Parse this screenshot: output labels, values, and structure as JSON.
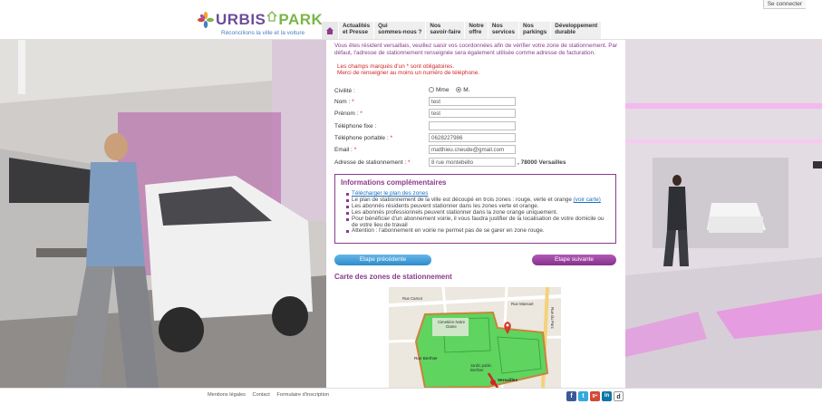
{
  "header": {
    "brand_part1": "URBIS",
    "brand_part2": "PARK",
    "tagline": "Réconcilions la ville et la voiture",
    "connect_label": "Se connecter"
  },
  "nav": {
    "items": [
      {
        "l1": "Actualités",
        "l2": "et Presse"
      },
      {
        "l1": "Qui",
        "l2": "sommes-nous ?"
      },
      {
        "l1": "Nos",
        "l2": "savoir-faire"
      },
      {
        "l1": "Notre",
        "l2": "offre"
      },
      {
        "l1": "Nos",
        "l2": "services"
      },
      {
        "l1": "Nos",
        "l2": "parkings"
      },
      {
        "l1": "Développement",
        "l2": "durable"
      }
    ]
  },
  "form": {
    "intro": "Vous êtes résident versaillais, veuillez saisir vos coordonnées afin de vérifier votre zone de stationnement. Par défaut, l'adresse de stationnement renseignée sera également utilisée comme adresse de facturation.",
    "warn1": "Les champs marqués d'un * sont obligatoires.",
    "warn2": "Merci de renseigner au moins un numéro de téléphone.",
    "civilite_label": "Civilité :",
    "civ_mme": "Mme",
    "civ_m": "M.",
    "nom_label": "Nom :",
    "nom_value": "test",
    "prenom_label": "Prénom :",
    "prenom_value": "test",
    "tel_fixe_label": "Téléphone fixe :",
    "tel_fixe_value": "",
    "tel_port_label": "Téléphone portable :",
    "tel_port_value": "0628227986",
    "email_label": "Email :",
    "email_value": "matthieu.cneude@gmail.com",
    "adresse_label": "Adresse de stationnement :",
    "adresse_value": "8 rue montebello",
    "ville": ", 78000 Versailles",
    "req": "*"
  },
  "info": {
    "title": "Informations complémentaires",
    "download_link": "Télécharger le plan des zones",
    "line1": "Le plan de stationnement de la ville est découpé en trois zones : rouge, verte et orange",
    "line1_link": "(voir carte)",
    "line2": "Les abonnés résidents peuvent stationner dans les zones verte et orange.",
    "line3": "Les abonnés professionnels peuvent stationner dans la zone orange uniquement.",
    "line4": "Pour bénéficier d'un abonnement voirie, il vous faudra justifier de la localisation de votre domicile ou de votre lieu de travail",
    "line5": "Attention : l'abonnement en voirie ne permet pas de se garer en zone rouge."
  },
  "buttons": {
    "prev": "Etape précédente",
    "next": "Etape suivante"
  },
  "map": {
    "title": "Carte des zones de stationnement",
    "labels": {
      "cimetiere": "Cimetière Notre Dame",
      "rue_berthier": "Rue Berthier",
      "rue_mansart": "Rue Mansart",
      "jardin": "Jardin public Berthier",
      "rue_carnot": "Rue Carnot",
      "rue_parc": "Rue du Parc",
      "versailles": "Versailles"
    }
  },
  "footer": {
    "links": [
      "Mentions légales",
      "Contact",
      "Formulaire d'inscription"
    ],
    "social": [
      "f",
      "t",
      "g+",
      "in",
      "d"
    ]
  },
  "colors": {
    "accent_purple": "#8b3a8e",
    "error_red": "#d02525",
    "blue_button": "#2d8ccc",
    "map_green": "#5fd45f"
  }
}
